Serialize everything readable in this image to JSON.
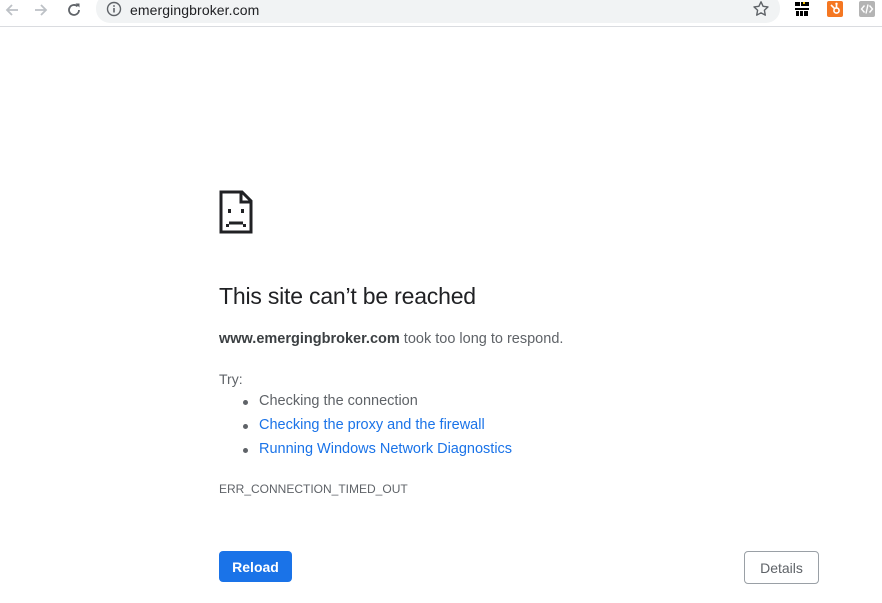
{
  "browser": {
    "url": "emergingbroker.com",
    "icons": {
      "back": "arrow-left-icon",
      "forward": "arrow-right-icon",
      "reload": "reload-icon",
      "info": "info-circle-icon",
      "bookmark": "star-icon"
    },
    "extensions": [
      "ipv6-ext-icon",
      "hubspot-ext-icon",
      "code-ext-icon"
    ]
  },
  "error_page": {
    "icon": "sad-document-icon",
    "title": "This site can’t be reached",
    "host": "www.emergingbroker.com",
    "message": " took too long to respond.",
    "try_label": "Try:",
    "suggestions": [
      {
        "text": "Checking the connection",
        "link": false
      },
      {
        "text": "Checking the proxy and the firewall",
        "link": true
      },
      {
        "text": "Running Windows Network Diagnostics",
        "link": true
      }
    ],
    "error_code": "ERR_CONNECTION_TIMED_OUT",
    "reload_label": "Reload",
    "details_label": "Details"
  },
  "colors": {
    "accent": "#1a73e8",
    "text_primary": "#202124",
    "text_secondary": "#5f6368"
  }
}
